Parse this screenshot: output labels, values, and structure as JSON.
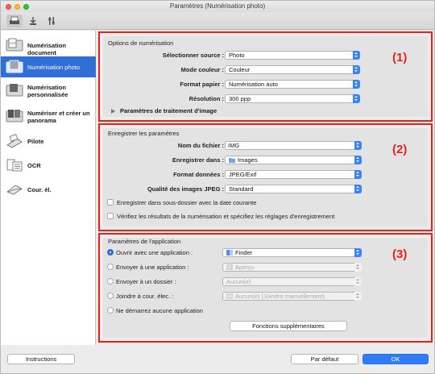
{
  "window": {
    "title": "Paramètres (Numérisation photo)"
  },
  "toolbar": {
    "tabs": [
      "scanner-icon",
      "download-icon",
      "tools-icon"
    ]
  },
  "sidebar": {
    "items": [
      {
        "label": "Numérisation document",
        "icon": "document-scan-icon",
        "active": false
      },
      {
        "label": "Numérisation photo",
        "icon": "photo-scan-icon",
        "active": true
      },
      {
        "label": "Numérisation\npersonnalisée",
        "icon": "custom-scan-icon",
        "active": false
      },
      {
        "label": "Numériser et créer un\npanorama",
        "icon": "panorama-icon",
        "active": false
      },
      {
        "label": "Pilote",
        "icon": "driver-icon",
        "active": false
      },
      {
        "label": "OCR",
        "icon": "ocr-icon",
        "active": false
      },
      {
        "label": "Cour. él.",
        "icon": "email-icon",
        "active": false
      }
    ]
  },
  "scan_options": {
    "title": "Options de numérisation",
    "number": "(1)",
    "source_label": "Sélectionner source :",
    "source_value": "Photo",
    "color_label": "Mode couleur :",
    "color_value": "Couleur",
    "paper_label": "Format papier :",
    "paper_value": "Numérisation auto",
    "resolution_label": "Résolution :",
    "resolution_value": "300 ppp",
    "image_processing": "Paramètres de traitement d'image"
  },
  "save_settings": {
    "title": "Enregistrer les paramètres",
    "number": "(2)",
    "filename_label": "Nom du fichier :",
    "filename_value": "IMG",
    "savein_label": "Enregistrer dans :",
    "savein_value": "Images",
    "format_label": "Format données :",
    "format_value": "JPEG/Exif",
    "quality_label": "Qualité des images JPEG :",
    "quality_value": "Standard",
    "subfolder_label": "Enregistrer dans sous-dossier avec la date courante",
    "check_label": "Vérifiez les résultats de la numérisation et spécifiez les réglages d'enregistrement"
  },
  "app_settings": {
    "title": "Paramètres de l'application",
    "number": "(3)",
    "open_label": "Ouvrir avec une application :",
    "open_value": "Finder",
    "send_app_label": "Envoyer à une application :",
    "send_app_value": "Aperçu",
    "send_folder_label": "Envoyer à un dossier :",
    "send_folder_value": "Aucun(e)",
    "attach_label": "Joindre à cour. élec. :",
    "attach_value": "Aucun(e) (Joindre manuellement)",
    "none_label": "Ne démarrez aucune application",
    "more_button": "Fonctions supplémentaires"
  },
  "footer": {
    "instructions": "Instructions",
    "default": "Par défaut",
    "ok": "OK"
  },
  "colors": {
    "accent": "#2f6fd6",
    "highlight": "#e2231a"
  }
}
